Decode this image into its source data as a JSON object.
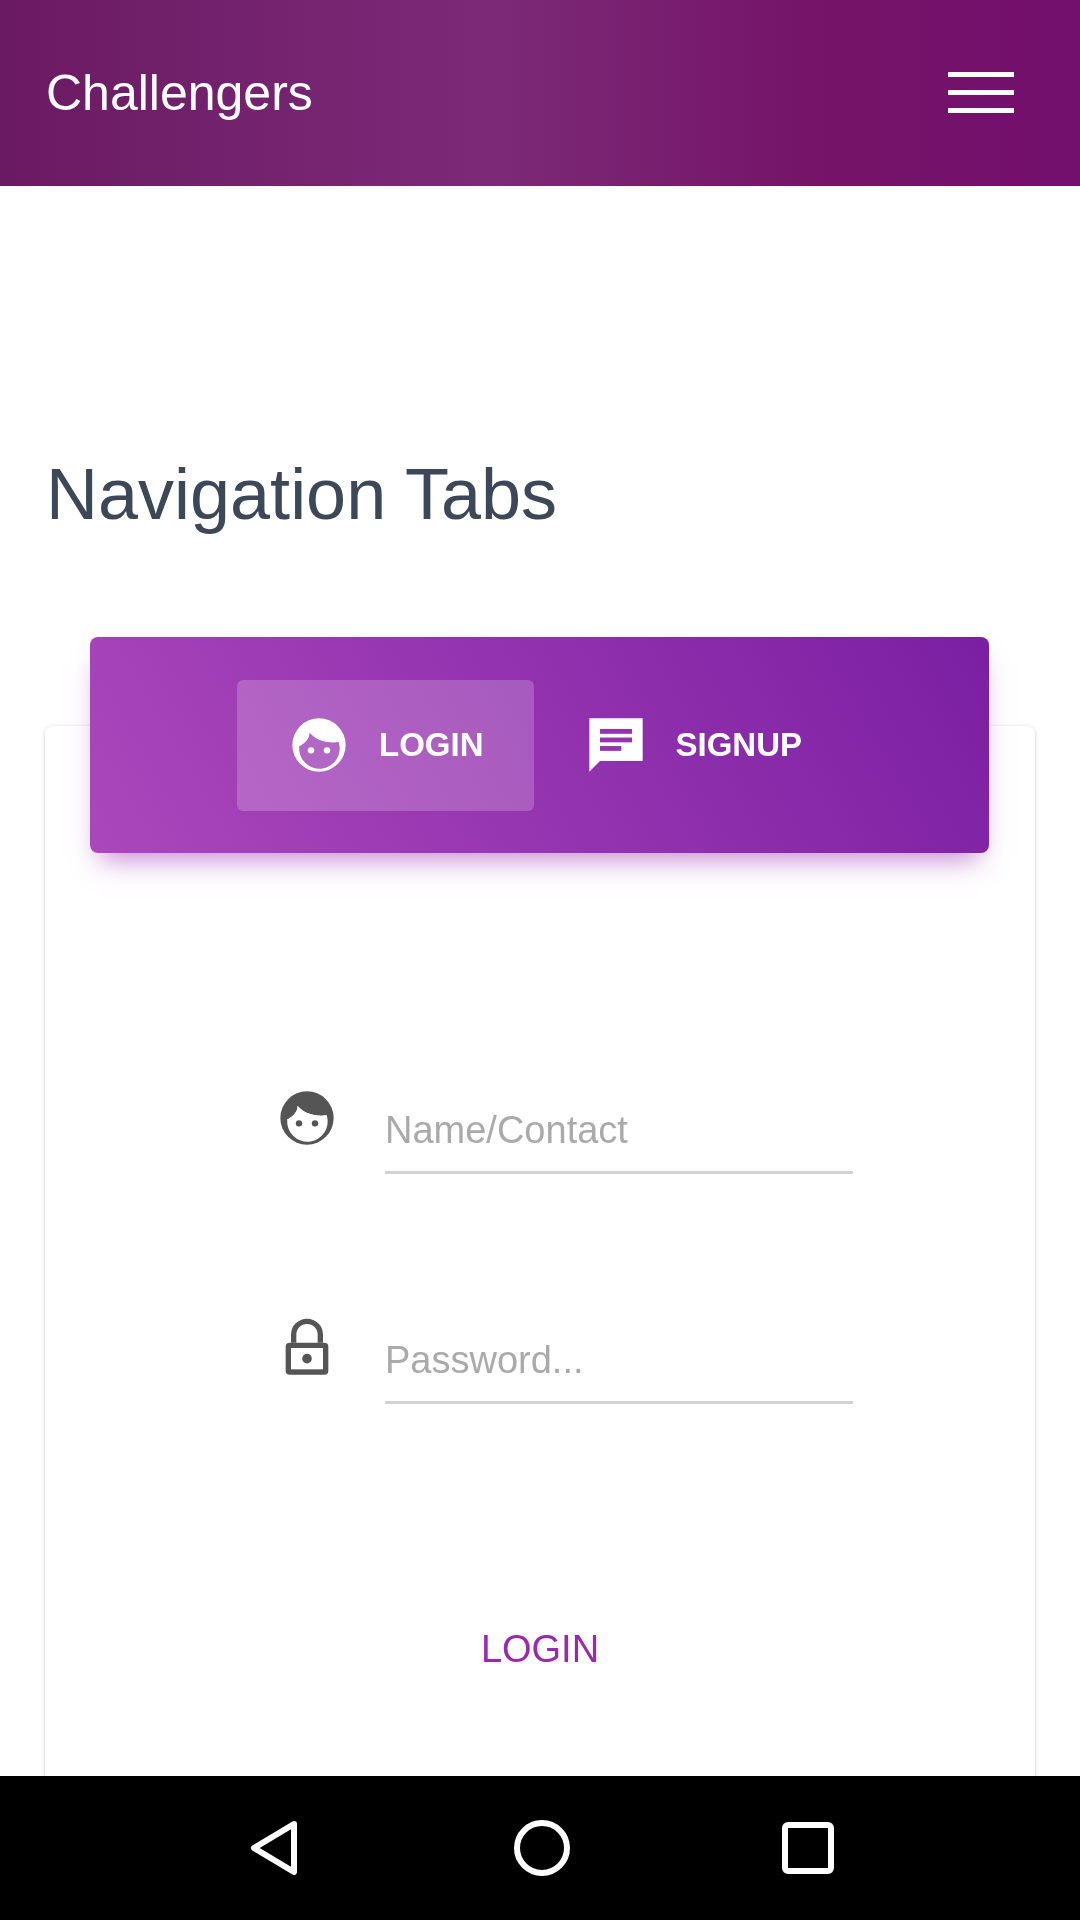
{
  "app_bar": {
    "title": "Challengers"
  },
  "heading": "Navigation Tabs",
  "tabs": [
    {
      "label": "LOGIN",
      "kind": "face",
      "selected": true
    },
    {
      "label": "SIGNUP",
      "kind": "chat",
      "selected": false
    }
  ],
  "fields": [
    {
      "kind": "face",
      "placeholder": "Name/Contact"
    },
    {
      "kind": "lock",
      "placeholder": "Password..."
    }
  ],
  "submit": "LOGIN"
}
